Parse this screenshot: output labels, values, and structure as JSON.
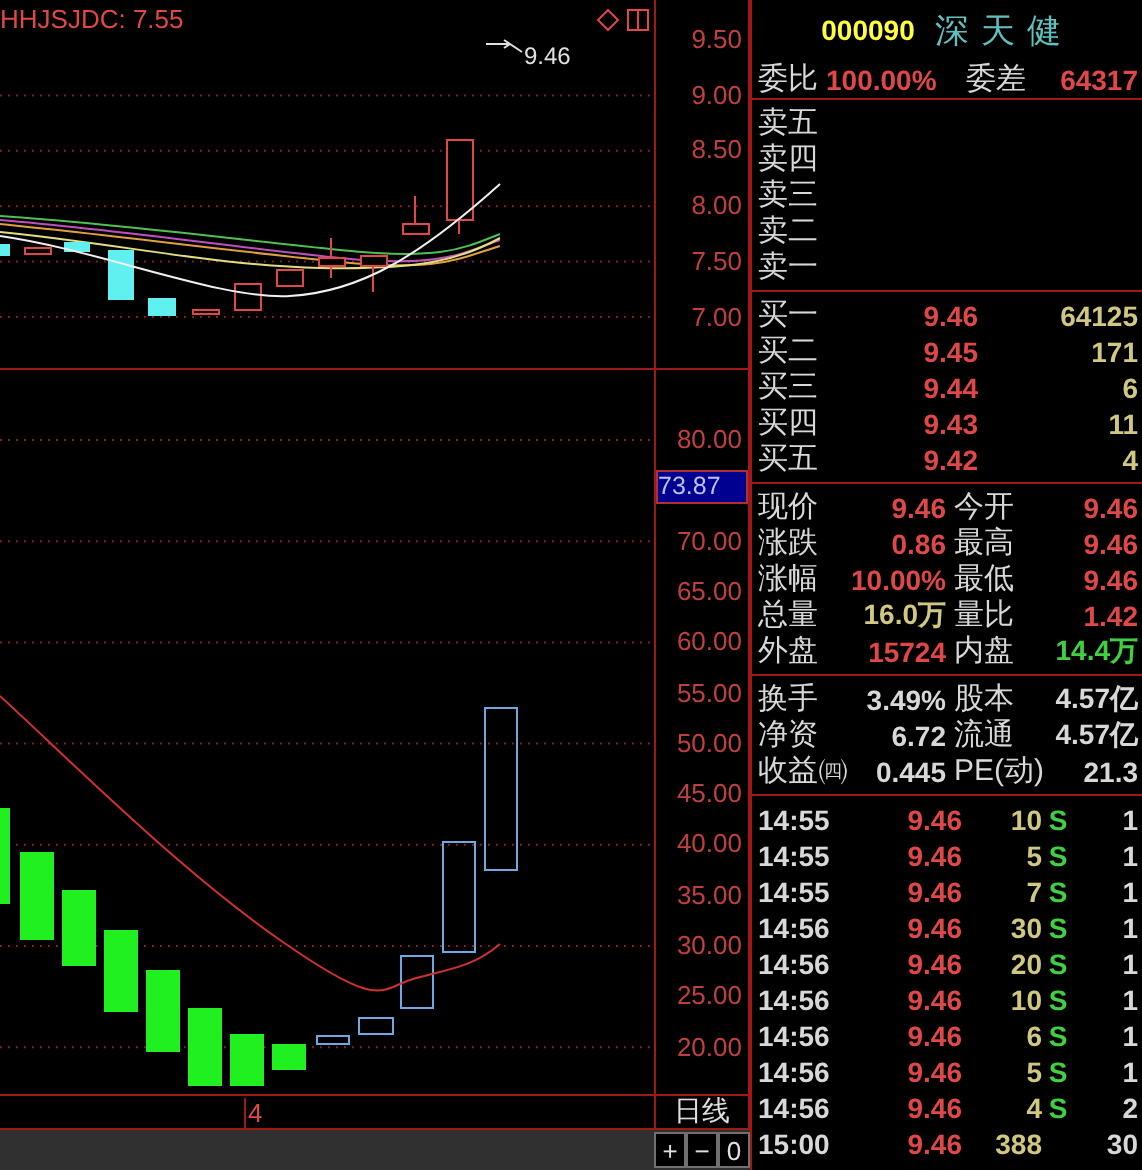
{
  "upper_chart": {
    "title": "HHJSJDC: 7.55",
    "price_marker": "9.46",
    "axis_labels": [
      "9.50",
      "9.00",
      "8.50",
      "8.00",
      "7.50",
      "7.00"
    ]
  },
  "lower_chart": {
    "axis_labels": [
      "80.00",
      "70.00",
      "65.00",
      "60.00",
      "55.00",
      "50.00",
      "45.00",
      "40.00",
      "35.00",
      "30.00",
      "25.00",
      "20.00"
    ],
    "current_value": "73.87",
    "date_label": "4",
    "period": "日线",
    "zoom_buttons": [
      "+",
      "−",
      "0"
    ]
  },
  "quote": {
    "code": "000090",
    "name": "深天健",
    "ratio_label": "委比",
    "ratio": "100.00%",
    "diff_label": "委差",
    "diff": "64317"
  },
  "asks": [
    {
      "label": "卖五"
    },
    {
      "label": "卖四"
    },
    {
      "label": "卖三"
    },
    {
      "label": "卖二"
    },
    {
      "label": "卖一"
    }
  ],
  "bids": [
    {
      "label": "买一",
      "price": "9.46",
      "volume": "64125"
    },
    {
      "label": "买二",
      "price": "9.45",
      "volume": "171"
    },
    {
      "label": "买三",
      "price": "9.44",
      "volume": "6"
    },
    {
      "label": "买四",
      "price": "9.43",
      "volume": "11"
    },
    {
      "label": "买五",
      "price": "9.42",
      "volume": "4"
    }
  ],
  "stats": [
    {
      "label": "现价",
      "value": "9.46",
      "color": "#e04848"
    },
    {
      "label": "今开",
      "value": "9.46",
      "color": "#e04848"
    },
    {
      "label": "涨跌",
      "value": "0.86",
      "color": "#e04848"
    },
    {
      "label": "最高",
      "value": "9.46",
      "color": "#e04848"
    },
    {
      "label": "涨幅",
      "value": "10.00%",
      "color": "#e04848"
    },
    {
      "label": "最低",
      "value": "9.46",
      "color": "#e04848"
    },
    {
      "label": "总量",
      "value": "16.0万",
      "color": "#d0c880"
    },
    {
      "label": "量比",
      "value": "1.42",
      "color": "#e04848"
    },
    {
      "label": "外盘",
      "value": "15724",
      "color": "#e04848"
    },
    {
      "label": "内盘",
      "value": "14.4万",
      "color": "#40d040"
    }
  ],
  "fundamentals": [
    {
      "label": "换手",
      "value": "3.49%"
    },
    {
      "label": "股本",
      "value": "4.57亿"
    },
    {
      "label": "净资",
      "value": "6.72"
    },
    {
      "label": "流通",
      "value": "4.57亿"
    },
    {
      "label": "收益㈣",
      "value": "0.445"
    },
    {
      "label": "PE(动)",
      "value": "21.3"
    }
  ],
  "trades": [
    {
      "time": "14:55",
      "price": "9.46",
      "volume": "10",
      "side": "S",
      "count": "1"
    },
    {
      "time": "14:55",
      "price": "9.46",
      "volume": "5",
      "side": "S",
      "count": "1"
    },
    {
      "time": "14:55",
      "price": "9.46",
      "volume": "7",
      "side": "S",
      "count": "1"
    },
    {
      "time": "14:56",
      "price": "9.46",
      "volume": "30",
      "side": "S",
      "count": "1"
    },
    {
      "time": "14:56",
      "price": "9.46",
      "volume": "20",
      "side": "S",
      "count": "1"
    },
    {
      "time": "14:56",
      "price": "9.46",
      "volume": "10",
      "side": "S",
      "count": "1"
    },
    {
      "time": "14:56",
      "price": "9.46",
      "volume": "6",
      "side": "S",
      "count": "1"
    },
    {
      "time": "14:56",
      "price": "9.46",
      "volume": "5",
      "side": "S",
      "count": "1"
    },
    {
      "time": "14:56",
      "price": "9.46",
      "volume": "4",
      "side": "S",
      "count": "2"
    },
    {
      "time": "15:00",
      "price": "9.46",
      "volume": "388",
      "count": "30"
    }
  ]
}
